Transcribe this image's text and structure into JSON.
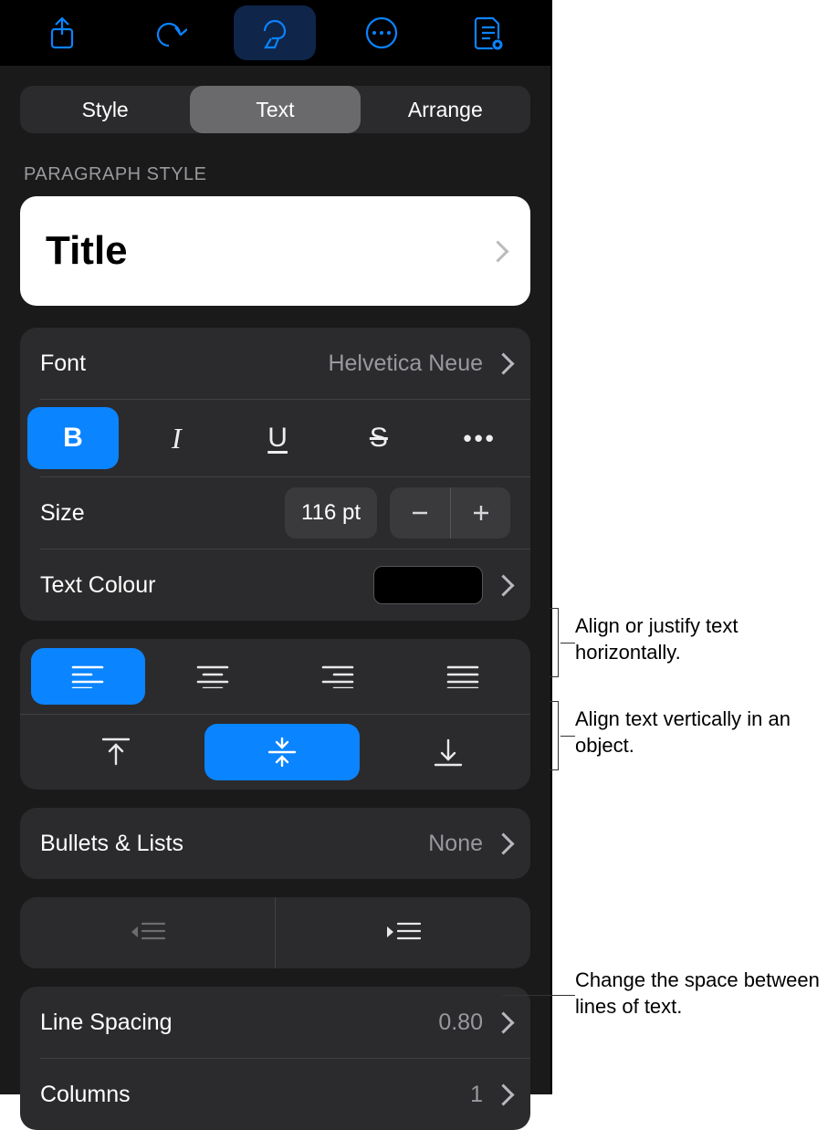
{
  "tabs": {
    "style": "Style",
    "text": "Text",
    "arrange": "Arrange"
  },
  "paragraph_style": {
    "header": "PARAGRAPH STYLE",
    "value": "Title"
  },
  "font": {
    "label": "Font",
    "value": "Helvetica Neue",
    "styles": {
      "bold": "B",
      "italic": "I",
      "underline": "U",
      "strike": "S",
      "more": "•••"
    }
  },
  "size": {
    "label": "Size",
    "value": "116 pt"
  },
  "text_colour": {
    "label": "Text Colour",
    "swatch": "#000000"
  },
  "bullets": {
    "label": "Bullets & Lists",
    "value": "None"
  },
  "line_spacing": {
    "label": "Line Spacing",
    "value": "0.80"
  },
  "columns": {
    "label": "Columns",
    "value": "1"
  },
  "callouts": {
    "halign": "Align or justify text horizontally.",
    "valign": "Align text vertically in an object.",
    "linespacing": "Change the space between lines of text."
  }
}
